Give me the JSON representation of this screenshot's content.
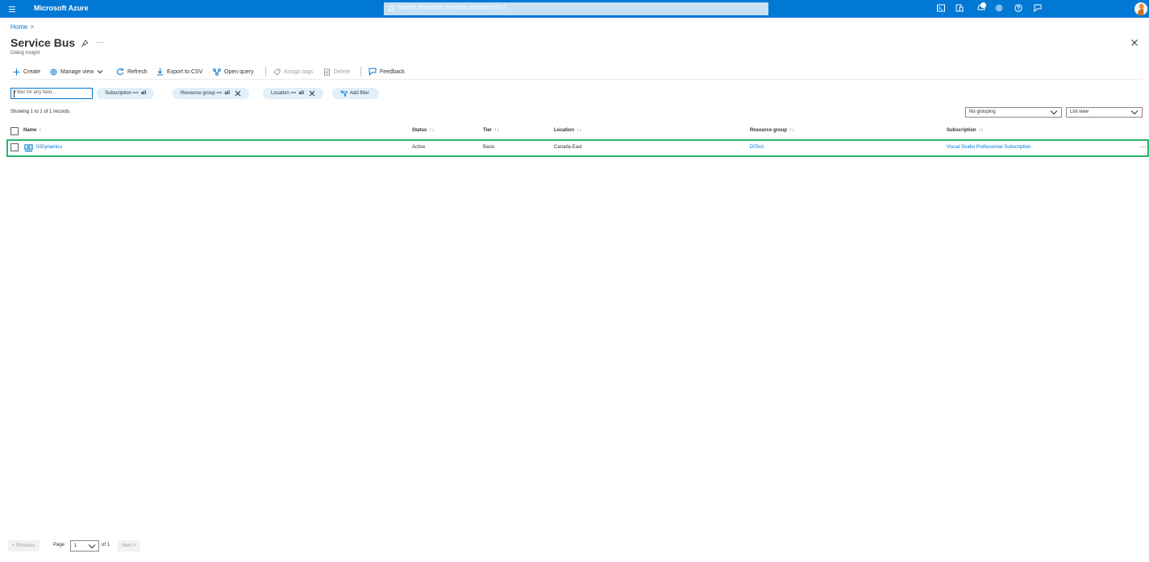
{
  "topbar": {
    "brand": "Microsoft Azure",
    "search_placeholder": "Search resources, services, and docs (G+/)",
    "icons": [
      "terminal-icon",
      "directory-icon",
      "notifications-icon",
      "settings-icon",
      "help-icon",
      "feedback-icon"
    ],
    "accent_color": "#0078d4"
  },
  "breadcrumb": {
    "home": "Home",
    "separator": ">"
  },
  "header": {
    "title": "Service Bus",
    "subtitle": "Dialog Insight",
    "more": "···"
  },
  "toolbar": {
    "create": "Create",
    "manage_view": "Manage view",
    "refresh": "Refresh",
    "export_csv": "Export to CSV",
    "open_query": "Open query",
    "assign_tags": "Assign tags",
    "delete": "Delete",
    "feedback": "Feedback"
  },
  "filters": {
    "input_placeholder": "Filter for any field...",
    "subscription_label": "Subscription ==",
    "subscription_value": "all",
    "resource_group_label": "Resource group ==",
    "resource_group_value": "all",
    "location_label": "Location ==",
    "location_value": "all",
    "add_filter": "Add filter"
  },
  "records_text": "Showing 1 to 1 of 1 records.",
  "grouping": {
    "selected": "No grouping"
  },
  "view": {
    "selected": "List view"
  },
  "table": {
    "columns": {
      "name": "Name",
      "status": "Status",
      "tier": "Tier",
      "location": "Location",
      "resource_group": "Resource group",
      "subscription": "Subscription"
    },
    "sort_glyph": "↑↓",
    "name_sort_glyph": "↑",
    "rows": [
      {
        "name": "DIDynamics",
        "status": "Active",
        "tier": "Basic",
        "location": "Canada East",
        "resource_group": "DITest",
        "subscription": "Visual Studio Professional Subscription",
        "more": "···"
      }
    ],
    "highlight_color": "#26b36f"
  },
  "pager": {
    "previous": "< Previous",
    "page_label": "Page",
    "page_value": "1",
    "of_label": "of 1",
    "next": "Next >"
  }
}
